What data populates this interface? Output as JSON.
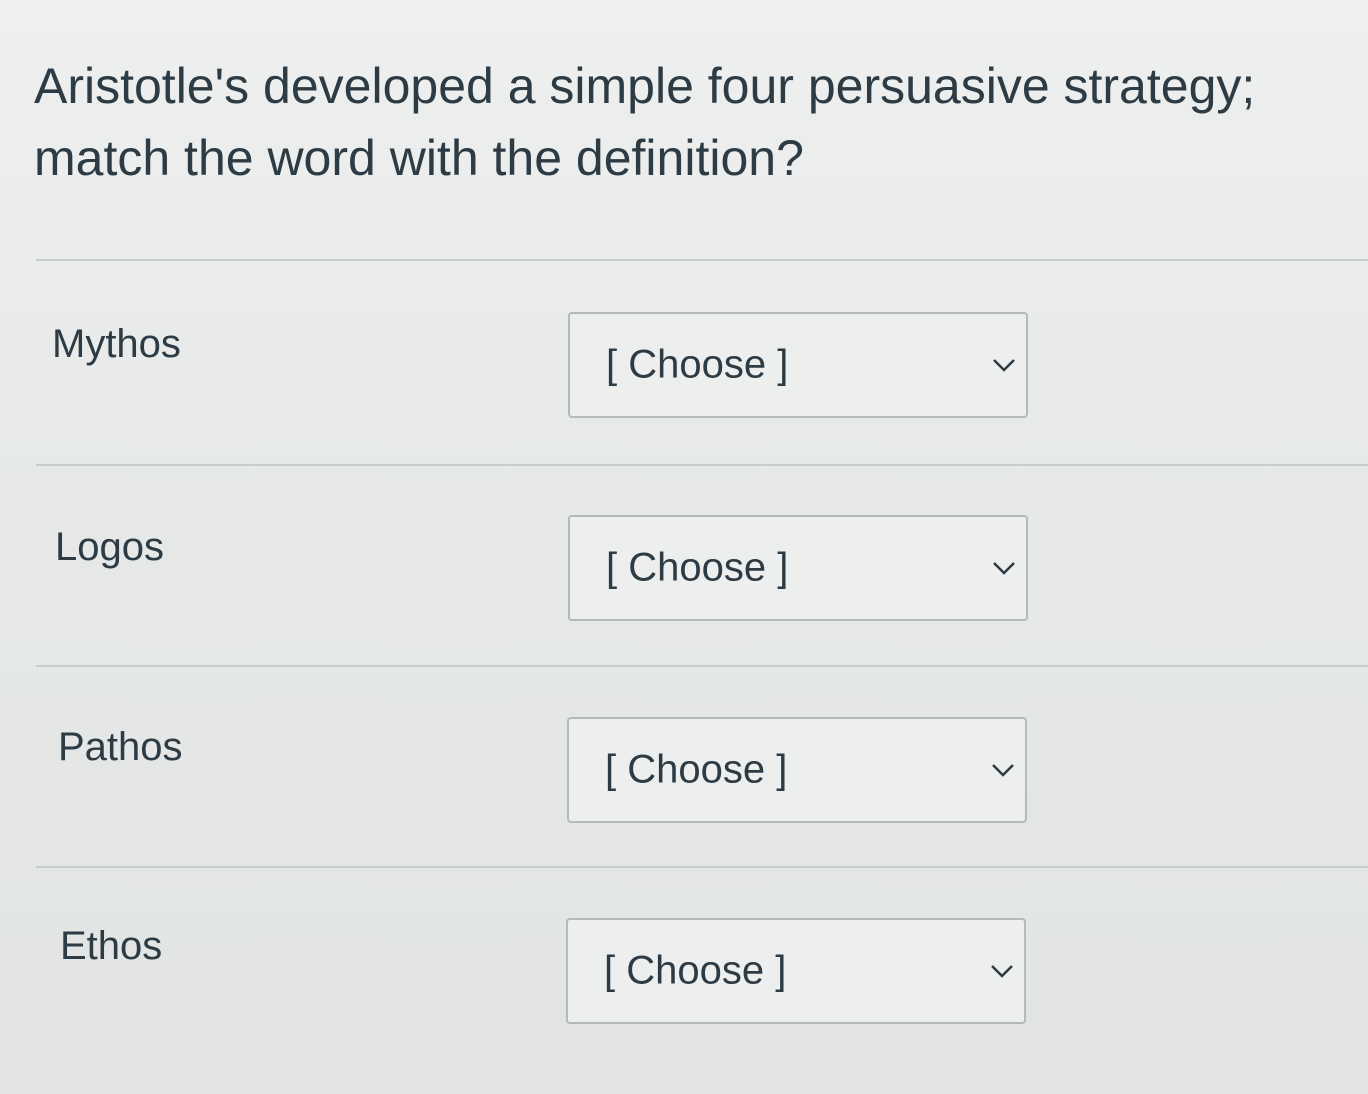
{
  "question": {
    "text": "Aristotle's developed a simple four persuasive strategy; match the word with the definition?"
  },
  "rows": [
    {
      "label": "Mythos",
      "select": {
        "value": "[ Choose ]",
        "icon": "chevron-down-icon"
      }
    },
    {
      "label": "Logos",
      "select": {
        "value": "[ Choose ]",
        "icon": "chevron-down-icon"
      }
    },
    {
      "label": "Pathos",
      "select": {
        "value": "[ Choose ]",
        "icon": "chevron-down-icon"
      }
    },
    {
      "label": "Ethos",
      "select": {
        "value": "[ Choose ]",
        "icon": "chevron-down-icon"
      }
    }
  ]
}
